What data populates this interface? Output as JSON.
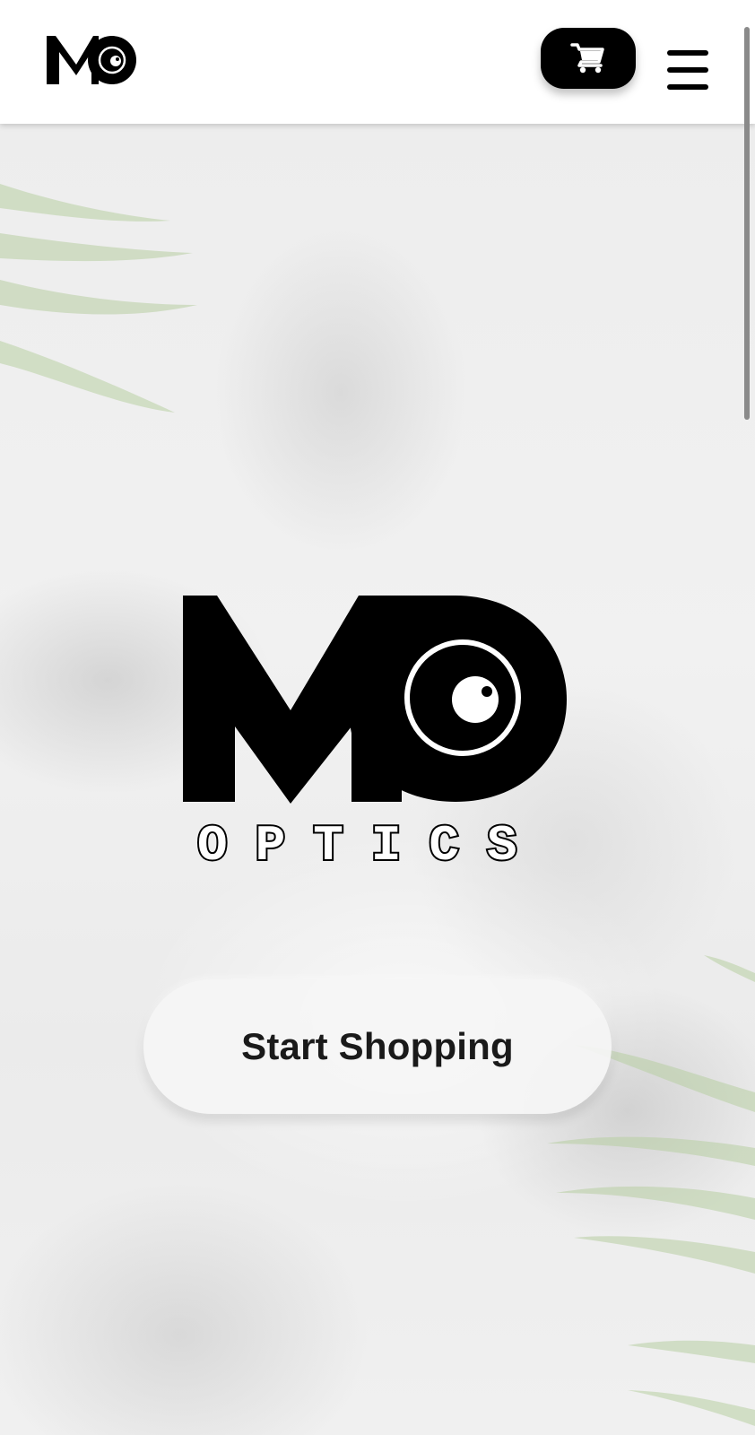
{
  "header": {
    "logo_alt": "MO Optics logo",
    "cart_icon": "cart-icon",
    "menu_icon": "hamburger-menu-icon"
  },
  "hero": {
    "logo_wordmark": "OPTICS",
    "cta_label": "Start Shopping"
  },
  "colors": {
    "header_bg": "#ffffff",
    "cart_button_bg": "#000000",
    "logo": "#000000",
    "cta_text": "#1a1a1a",
    "leaf_green": "#b9cfa6"
  }
}
